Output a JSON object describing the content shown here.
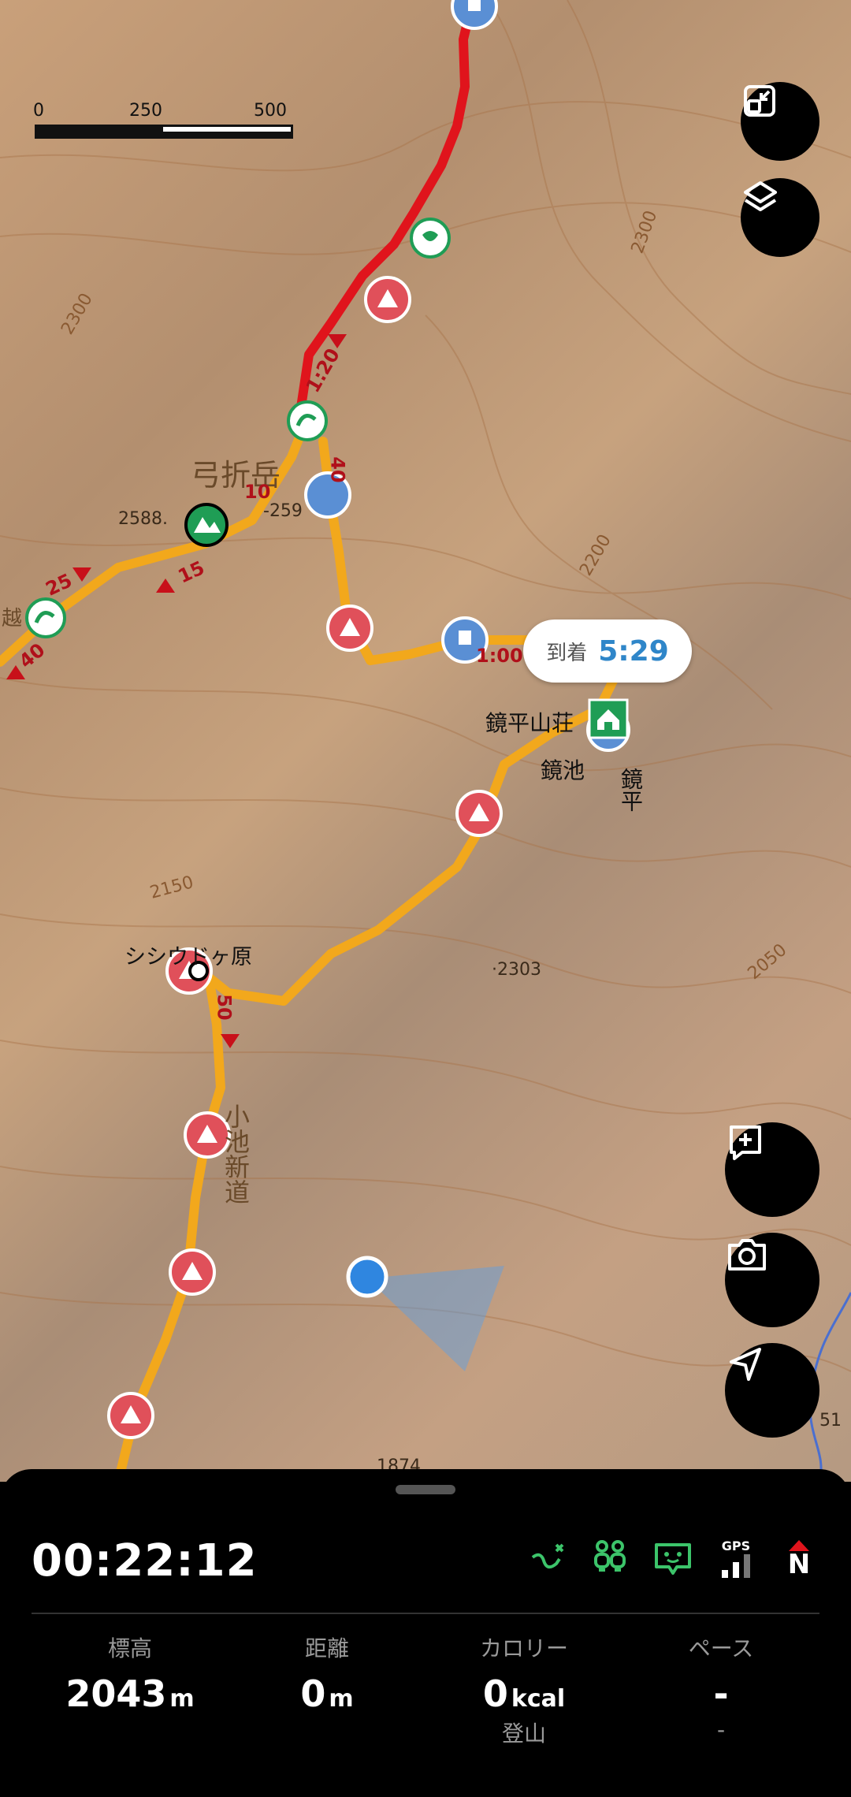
{
  "map": {
    "scale": {
      "zero": "0",
      "mid": "250 m",
      "end": "500 m"
    },
    "labels": {
      "peak_name": "弓折岳",
      "elev_2588": "2588.",
      "elev_259": "-259",
      "elev_2303": "·2303",
      "elev_2150": "2150",
      "elev_2300": "2300",
      "elev_2050": "2050",
      "elev_2200": "2200",
      "elev_1874": "1874",
      "hut": "鏡平山荘",
      "pond": "鏡池",
      "area": "鏡平",
      "shishiudo": "シシウドヶ原",
      "new_trail": "小池新道",
      "cut_left": "越"
    },
    "route_times": {
      "t_120": "1:20",
      "t_40a": "40",
      "t_10": "10",
      "t_25": "25",
      "t_15": "15",
      "t_40b": "40",
      "t_100": "1:00",
      "t_50": "50",
      "t_51": "51"
    },
    "arrival": {
      "label": "到着",
      "time": "5:29"
    }
  },
  "fabs": {
    "fit_icon": "fit-bounds-icon",
    "layers_icon": "layers-icon",
    "memo_icon": "add-memo-icon",
    "camera_icon": "camera-icon",
    "locate_icon": "navigate-icon"
  },
  "sheet": {
    "timer": "00:22:12",
    "status_icons": [
      "route-icon",
      "people-icon",
      "chat-icon",
      "gps-signal-icon",
      "compass-north-icon"
    ],
    "gps_label": "GPS",
    "compass_label": "N",
    "stats": [
      {
        "label": "標高",
        "value": "2043",
        "unit": "m",
        "sub": ""
      },
      {
        "label": "距離",
        "value": "0",
        "unit": "m",
        "sub": ""
      },
      {
        "label": "カロリー",
        "value": "0",
        "unit": "kcal",
        "sub": "登山"
      },
      {
        "label": "ペース",
        "value": "-",
        "unit": "",
        "sub": "-"
      }
    ]
  },
  "colors": {
    "route_red": "#e0141c",
    "trail_orange": "#f2a81c",
    "hazard": "#e0505a",
    "accent_green": "#1f9d55",
    "arrival_blue": "#2f86c9"
  }
}
